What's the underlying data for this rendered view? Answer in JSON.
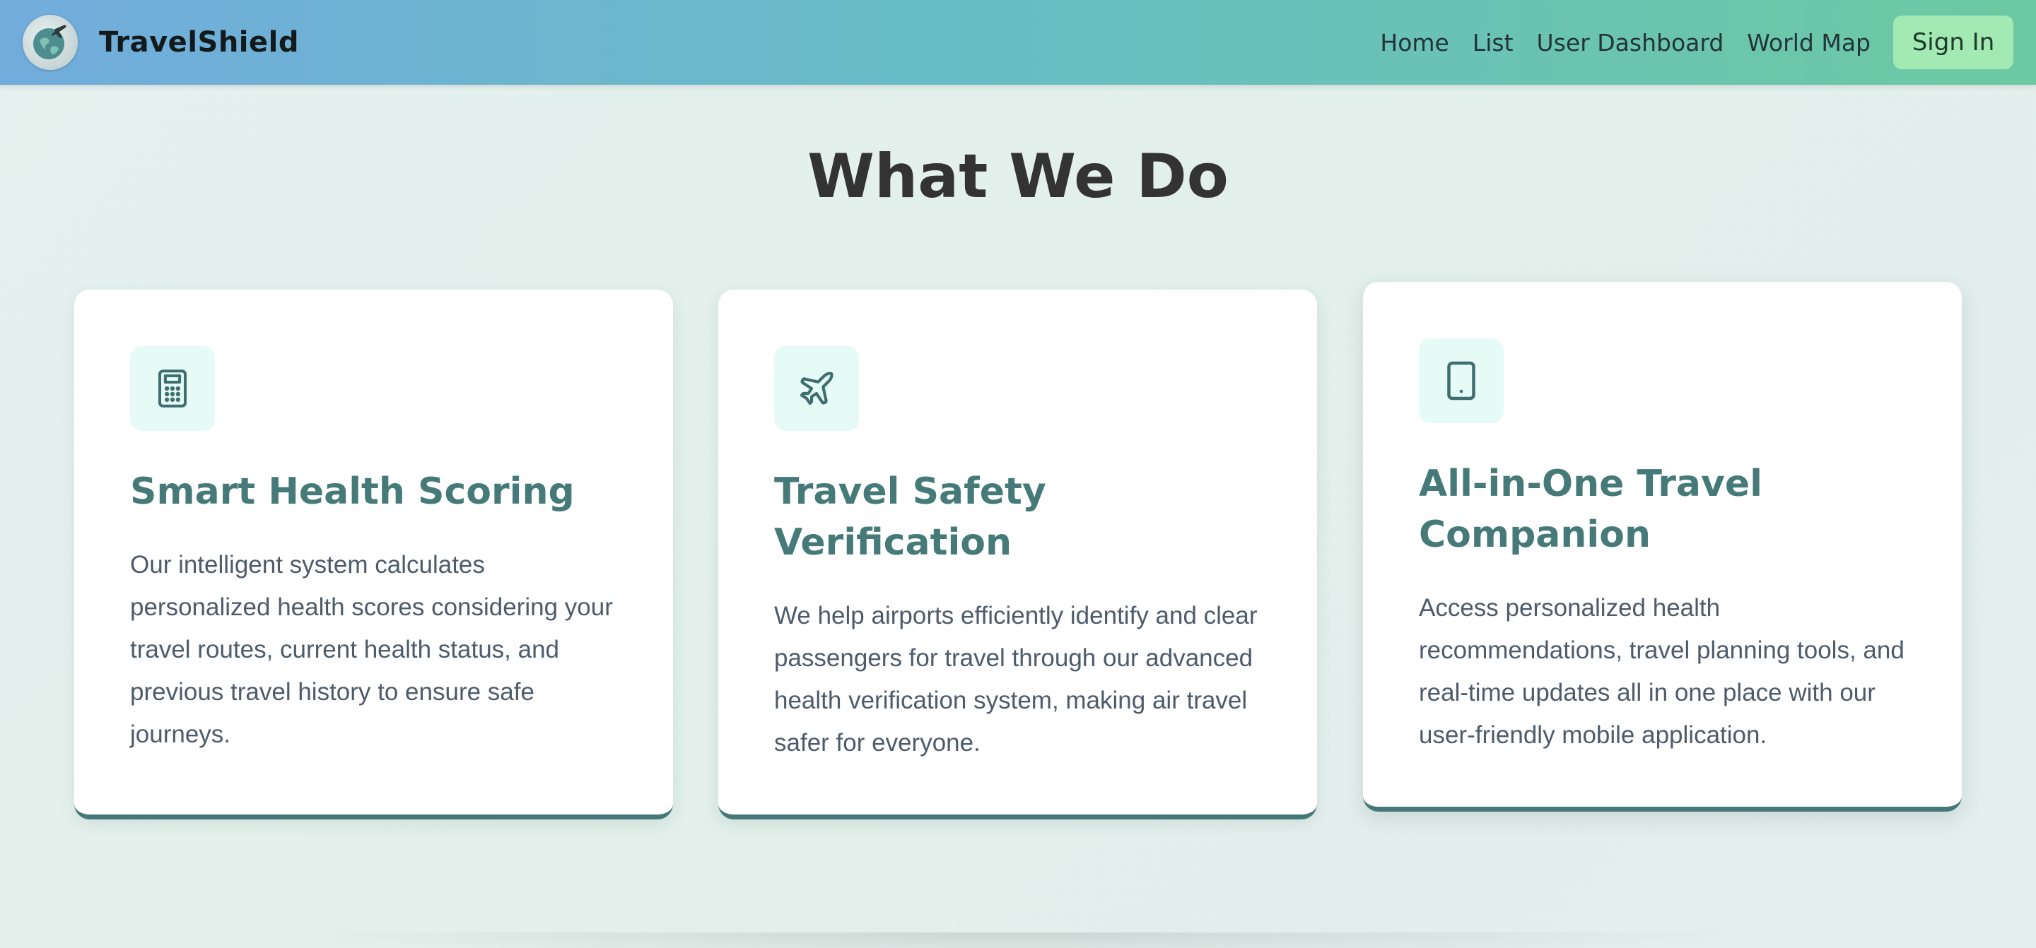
{
  "nav": {
    "brand": "TravelShield",
    "links": [
      "Home",
      "List",
      "User Dashboard",
      "World Map"
    ],
    "sign_in": "Sign In"
  },
  "section": {
    "title": "What We Do"
  },
  "cards": [
    {
      "icon": "calculator-icon",
      "title": "Smart Health Scoring",
      "text": "Our intelligent system calculates personalized health scores considering your travel routes, current health status, and previous travel history to ensure safe journeys."
    },
    {
      "icon": "airplane-icon",
      "title": "Travel Safety Verification",
      "text": "We help airports efficiently identify and clear passengers for travel through our advanced health verification system, making air travel safer for everyone."
    },
    {
      "icon": "tablet-icon",
      "title": "All-in-One Travel Companion",
      "text": "Access personalized health recommendations, travel planning tools, and real-time updates all in one place with our user-friendly mobile application."
    }
  ],
  "colors": {
    "accent": "#457a78",
    "icon_bg": "#e7fbf6",
    "sign_in_bg": "#a2e9b3"
  }
}
